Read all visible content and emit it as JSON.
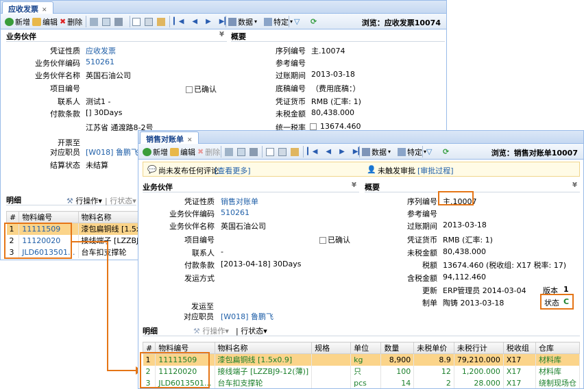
{
  "back": {
    "tab_title": "应收发票",
    "tab_close": "✕",
    "toolbar": {
      "new": "新增",
      "edit": "编辑",
      "delete": "删除",
      "data": "数据",
      "special": "特定"
    },
    "browse": "浏览：应收发票10074",
    "partner_section": "业务伙伴",
    "summary_section": "概要",
    "partner_fields": [
      {
        "label": "凭证性质",
        "value": "应收发票",
        "link": true
      },
      {
        "label": "业务伙伴编码",
        "value": "510261",
        "link": true
      },
      {
        "label": "业务伙伴名称",
        "value": "英国石油公司",
        "link": false
      },
      {
        "label": "项目编号",
        "value": "",
        "link": false
      },
      {
        "label": "联系人",
        "value": "测试1 -",
        "link": false
      },
      {
        "label": "付款条款",
        "value": "[] 30Days",
        "link": false
      },
      {
        "label": "",
        "value": "江苏省 通渡路8-2号",
        "link": false
      },
      {
        "label": "开票至",
        "value": "",
        "link": false
      },
      {
        "label": "对应职员",
        "value": "[W018] 鲁鹏飞",
        "link": true
      },
      {
        "label": "结算状态",
        "value": "未结算",
        "link": false
      }
    ],
    "confirmed": "已确认",
    "summary_fields": [
      {
        "label": "序列编号",
        "value": "主.10074"
      },
      {
        "label": "参考编号",
        "value": ""
      },
      {
        "label": "过账期间",
        "value": "2013-03-18"
      },
      {
        "label": "底稿编号",
        "value": "（费用底稿：）"
      },
      {
        "label": "凭证货币",
        "value": "RMB (汇率: 1)"
      },
      {
        "label": "未税金额",
        "value": "80,438.000"
      },
      {
        "label": "统一税率",
        "value": "13674.460"
      }
    ],
    "detail_title": "明细",
    "row_ops": "行操作",
    "row_status": "行状态",
    "grid_headers": [
      "#",
      "物料编号",
      "物料名称"
    ],
    "grid_rows": [
      [
        "1",
        "11111509",
        "漆包扁铜线 [1.5x0.9"
      ],
      [
        "2",
        "11120020",
        "接线端子 [LZZBJ9-1"
      ],
      [
        "3",
        "JLD6013501...",
        "台车扣支撑轮"
      ]
    ]
  },
  "front": {
    "tab_title": "销售对账单",
    "tab_close": "✕",
    "toolbar": {
      "new": "新增",
      "edit": "编辑",
      "delete": "删除",
      "data": "数据",
      "special": "特定"
    },
    "browse": "浏览：销售对账单10007",
    "notice_comment": "尚未发布任何评论",
    "notice_view_more": "[查看更多]",
    "notice_approval": "未触发审批",
    "notice_approval_process": "[审批过程]",
    "partner_section": "业务伙伴",
    "summary_section": "概要",
    "partner_fields": [
      {
        "label": "凭证性质",
        "value": "销售对账单",
        "link": true
      },
      {
        "label": "业务伙伴编码",
        "value": "510261",
        "link": true
      },
      {
        "label": "业务伙伴名称",
        "value": "英国石油公司",
        "link": false
      },
      {
        "label": "项目编号",
        "value": "",
        "link": false
      },
      {
        "label": "联系人",
        "value": "-",
        "link": false
      },
      {
        "label": "付款条款",
        "value": "[2013-04-18] 30Days",
        "link": false
      },
      {
        "label": "发运方式",
        "value": "",
        "link": false
      }
    ],
    "ship_to": "发运至",
    "staff_label": "对应职员",
    "staff_value": "[W018] 鲁鹏飞",
    "confirmed": "已确认",
    "summary_fields": [
      {
        "label": "序列编号",
        "value": "主.10007"
      },
      {
        "label": "参考编号",
        "value": ""
      },
      {
        "label": "过账期间",
        "value": "2013-03-18"
      },
      {
        "label": "凭证货币",
        "value": "RMB (汇率: 1)"
      },
      {
        "label": "未税金额",
        "value": "80,438.000"
      },
      {
        "label": "税额",
        "value": "13674.460 (税收组: X17 税率: 17)"
      },
      {
        "label": "含税金额",
        "value": "94,112.460"
      },
      {
        "label": "更新",
        "value": "ERP管理员 2014-03-04"
      },
      {
        "label": "制单",
        "value": "陶铸 2013-03-18"
      }
    ],
    "version_label": "版本",
    "version_value": "1",
    "status_label": "状态",
    "status_value": "C",
    "detail_title": "明细",
    "row_ops": "行操作",
    "row_status": "行状态",
    "grid_headers": [
      "#",
      "物料编号",
      "物料名称",
      "规格",
      "单位",
      "数量",
      "未税单价",
      "未税行计",
      "税收组",
      "仓库"
    ],
    "grid_rows": [
      [
        "1",
        "11111509",
        "漆包扁铜线 [1.5x0.9]",
        "",
        "kg",
        "8,900",
        "8.9",
        "79,210.000",
        "X17",
        "材料库"
      ],
      [
        "2",
        "11120020",
        "接线端子 [LZZBJ9-12(薄)]",
        "",
        "只",
        "100",
        "12",
        "1,200.000",
        "X17",
        "材料库"
      ],
      [
        "3",
        "JLD6013501...",
        "台车扣支撑轮",
        "",
        "pcs",
        "14",
        "2",
        "28.000",
        "X17",
        "绕制现场仓"
      ]
    ]
  }
}
